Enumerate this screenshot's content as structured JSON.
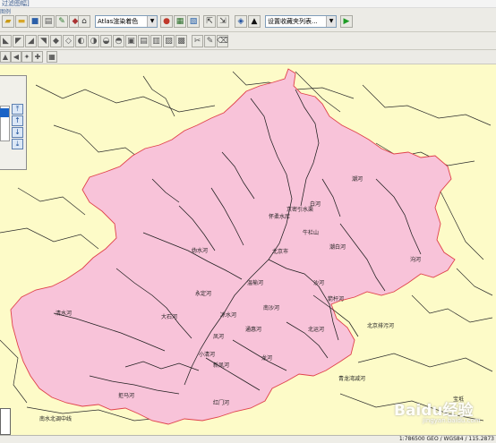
{
  "window": {
    "title_fragment": "过滤图幅]",
    "menu_hint": "图例"
  },
  "toolbar": {
    "render_combo": "Atlas渲染着色",
    "bookmark_combo": "设置收藏夹列表...",
    "play_icon": "play-icon"
  },
  "map": {
    "background_color": "#fdfbc8",
    "region_color": "#f8c3d9",
    "river_color": "#1e1e1e",
    "boundary_color": "#e0414b",
    "region_labels": [
      {
        "text": "北京市"
      },
      {
        "text": "潮河"
      },
      {
        "text": "白河"
      },
      {
        "text": "怀柔水库"
      },
      {
        "text": "牛栏山"
      },
      {
        "text": "京密引水渠"
      },
      {
        "text": "温榆河"
      },
      {
        "text": "永定河"
      },
      {
        "text": "清水河"
      },
      {
        "text": "凉水河"
      },
      {
        "text": "凤河"
      },
      {
        "text": "通惠河"
      },
      {
        "text": "北运河"
      },
      {
        "text": "潮白河"
      },
      {
        "text": "拒马河"
      },
      {
        "text": "小清河"
      },
      {
        "text": "大石河"
      },
      {
        "text": "泃河"
      },
      {
        "text": "箭杆河"
      },
      {
        "text": "妫水河"
      },
      {
        "text": "龙河"
      },
      {
        "text": "新凤河"
      },
      {
        "text": "沙河"
      },
      {
        "text": "红门河"
      },
      {
        "text": "南沙河"
      }
    ],
    "outside_labels": [
      {
        "text": "青龙湾减河"
      },
      {
        "text": "南水北调中线"
      },
      {
        "text": "宝坻"
      },
      {
        "text": "北京排污河"
      }
    ]
  },
  "statusbar": {
    "coords": "1:786500 GEO / WGS84 / 115.2873"
  },
  "watermark": {
    "text": "Baidu经验",
    "sub": "jingyan.baidu.com"
  }
}
